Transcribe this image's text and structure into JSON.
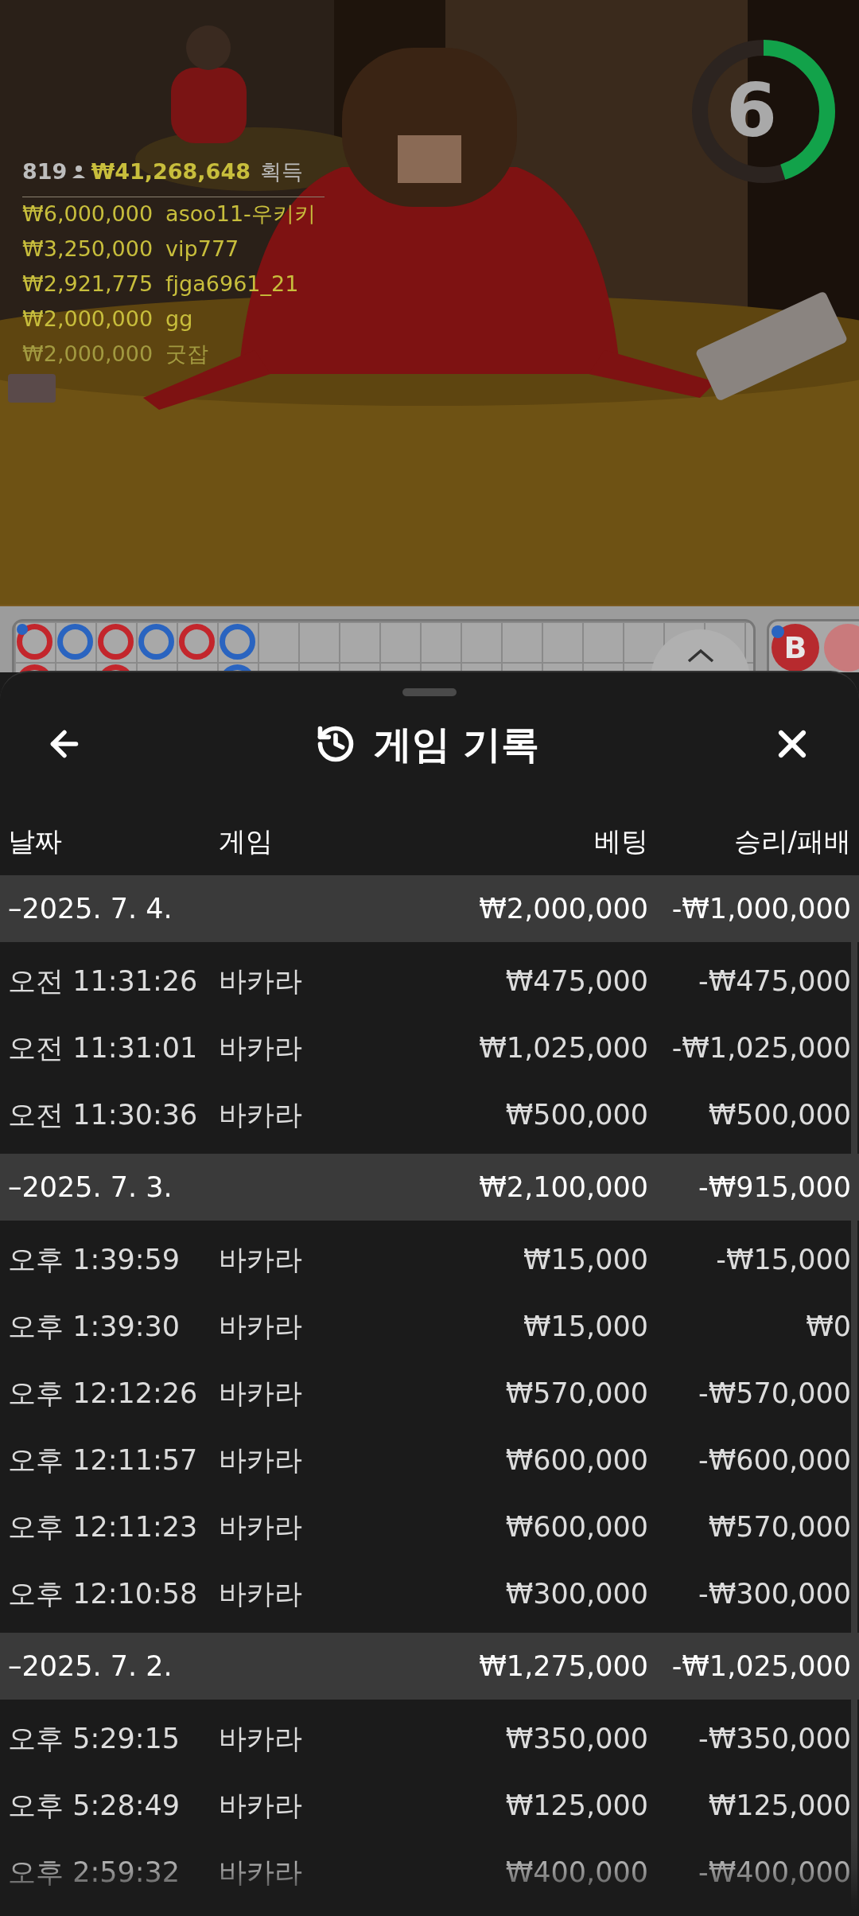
{
  "timer": {
    "count": "6",
    "level": 0.45
  },
  "winners": {
    "players": "819",
    "total": "₩41,268,648",
    "suffix": "획득",
    "list": [
      {
        "amount": "₩6,000,000",
        "name": "asoo11-우키키",
        "faded": false
      },
      {
        "amount": "₩3,250,000",
        "name": "vip777",
        "faded": false
      },
      {
        "amount": "₩2,921,775",
        "name": "fjga6961_21",
        "faded": false
      },
      {
        "amount": "₩2,000,000",
        "name": "gg",
        "faded": false
      },
      {
        "amount": "₩2,000,000",
        "name": "굿잡",
        "faded": true
      }
    ]
  },
  "roadmap": {
    "rows": [
      {
        "beads": [
          {
            "kind": "ring",
            "color": "#c3262c",
            "dot": true
          },
          {
            "kind": "ring",
            "color": "#2a64c0",
            "dot": false
          },
          {
            "kind": "ring",
            "color": "#c3262c",
            "dot": false
          },
          {
            "kind": "ring",
            "color": "#2a64c0",
            "dot": false
          },
          {
            "kind": "ring",
            "color": "#c3262c",
            "dot": false
          },
          {
            "kind": "ring",
            "color": "#2a64c0",
            "dot": false
          }
        ]
      },
      {
        "beads": [
          {
            "kind": "ring",
            "color": "#c3262c",
            "dot": false
          },
          {
            "kind": "empty"
          },
          {
            "kind": "ring",
            "color": "#c3262c",
            "dot": false
          },
          {
            "kind": "empty"
          },
          {
            "kind": "empty"
          },
          {
            "kind": "ring",
            "color": "#2a64c0",
            "dot": false
          }
        ]
      }
    ],
    "badge": "B"
  },
  "sheet": {
    "title": "게임 기록",
    "columns": [
      "날짜",
      "게임",
      "베팅",
      "승리/패배"
    ],
    "groups": [
      {
        "date": "–2025. 7. 4.",
        "bet": "₩2,000,000",
        "result": "-₩1,000,000",
        "rows": [
          {
            "time": "오전 11:31:26",
            "game": "바카라",
            "bet": "₩475,000",
            "result": "-₩475,000"
          },
          {
            "time": "오전 11:31:01",
            "game": "바카라",
            "bet": "₩1,025,000",
            "result": "-₩1,025,000"
          },
          {
            "time": "오전 11:30:36",
            "game": "바카라",
            "bet": "₩500,000",
            "result": "₩500,000"
          }
        ]
      },
      {
        "date": "–2025. 7. 3.",
        "bet": "₩2,100,000",
        "result": "-₩915,000",
        "rows": [
          {
            "time": "오후 1:39:59",
            "game": "바카라",
            "bet": "₩15,000",
            "result": "-₩15,000"
          },
          {
            "time": "오후 1:39:30",
            "game": "바카라",
            "bet": "₩15,000",
            "result": "₩0"
          },
          {
            "time": "오후 12:12:26",
            "game": "바카라",
            "bet": "₩570,000",
            "result": "-₩570,000"
          },
          {
            "time": "오후 12:11:57",
            "game": "바카라",
            "bet": "₩600,000",
            "result": "-₩600,000"
          },
          {
            "time": "오후 12:11:23",
            "game": "바카라",
            "bet": "₩600,000",
            "result": "₩570,000"
          },
          {
            "time": "오후 12:10:58",
            "game": "바카라",
            "bet": "₩300,000",
            "result": "-₩300,000"
          }
        ]
      },
      {
        "date": "–2025. 7. 2.",
        "bet": "₩1,275,000",
        "result": "-₩1,025,000",
        "rows": [
          {
            "time": "오후 5:29:15",
            "game": "바카라",
            "bet": "₩350,000",
            "result": "-₩350,000"
          },
          {
            "time": "오후 5:28:49",
            "game": "바카라",
            "bet": "₩125,000",
            "result": "₩125,000"
          },
          {
            "time": "오후 2:59:32",
            "game": "바카라",
            "bet": "₩400,000",
            "result": "-₩400,000"
          }
        ]
      }
    ]
  }
}
